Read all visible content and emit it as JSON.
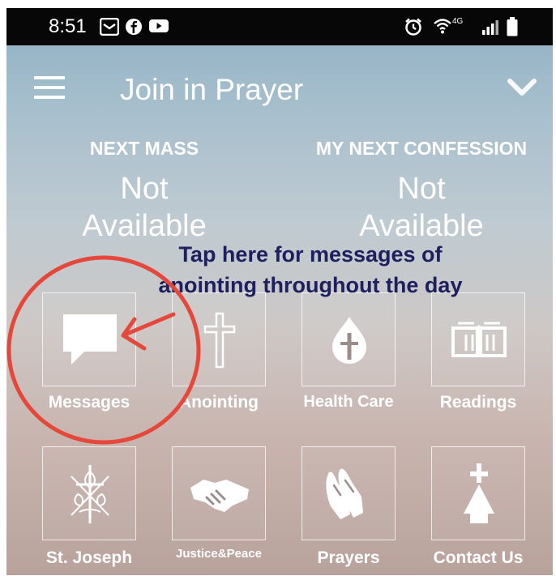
{
  "status_bar": {
    "time": "8:51",
    "network": "4G"
  },
  "app_bar": {
    "title": "Join in Prayer"
  },
  "next_mass": {
    "label": "NEXT MASS",
    "value_line1": "Not",
    "value_line2": "Available"
  },
  "next_confession": {
    "label": "MY NEXT CONFESSION",
    "value_line1": "Not",
    "value_line2": "Available"
  },
  "annotation": {
    "line1": "Tap here for messages of",
    "line2": "anointing throughout the day",
    "color": "#1e1f5e",
    "callout_color": "#e5473b"
  },
  "tiles": [
    {
      "label": "Messages",
      "icon": "message-bubble-icon"
    },
    {
      "label": "Anointing",
      "icon": "cross-icon"
    },
    {
      "label": "Health Care",
      "icon": "drop-cross-icon"
    },
    {
      "label": "Readings",
      "icon": "book-icon"
    },
    {
      "label": "St. Joseph",
      "icon": "lily-cross-icon"
    },
    {
      "label": "Justice&Peace",
      "icon": "handshake-icon"
    },
    {
      "label": "Prayers",
      "icon": "praying-hands-icon"
    },
    {
      "label": "Contact Us",
      "icon": "church-icon"
    }
  ]
}
